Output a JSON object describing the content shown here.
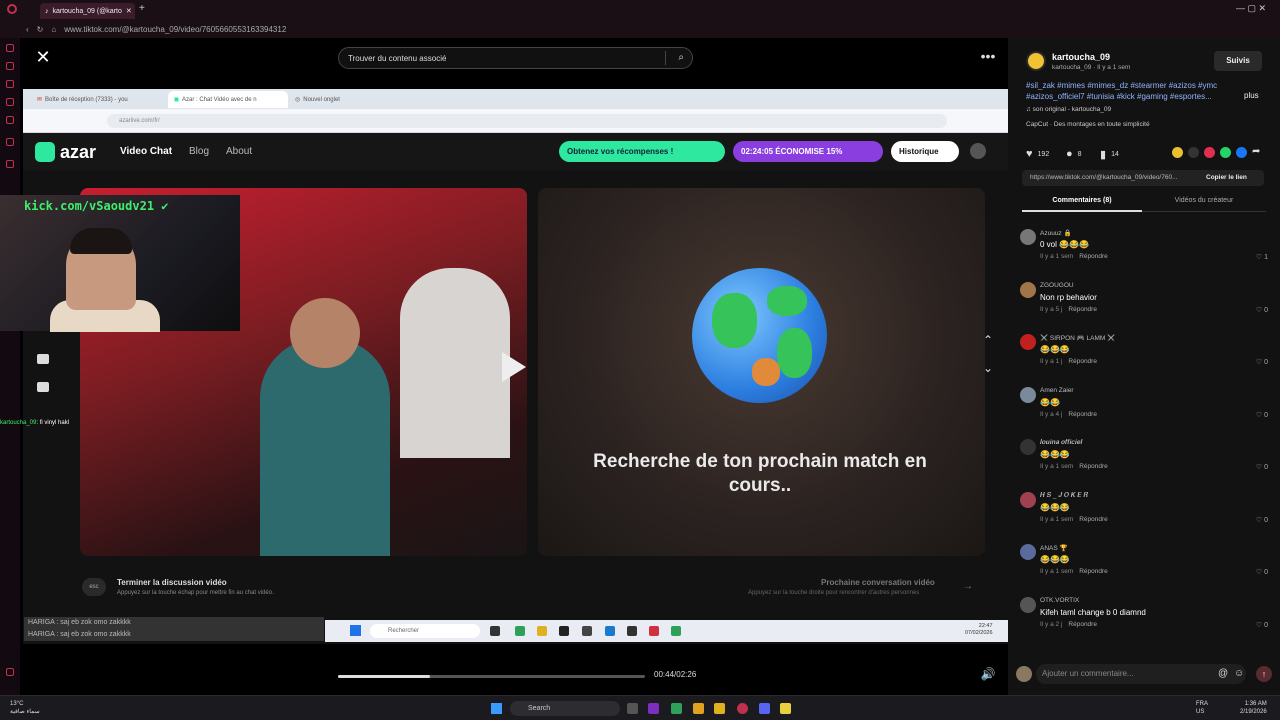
{
  "browser": {
    "tab_title": "kartoucha_09 (@karto",
    "url": "www.tiktok.com/@kartoucha_09/video/7605660553163394312"
  },
  "player": {
    "search_placeholder": "Trouver du contenu associé",
    "time": "00:44/02:26",
    "progress": 0.3
  },
  "inner_screen": {
    "tabs": [
      "Boîte de réception (7333) - you",
      "Azar : Chat Vidéo avec de n",
      "Nouvel onglet"
    ],
    "url": "azarlive.com/fr/",
    "brand": "azar",
    "nav": [
      "Video Chat",
      "Blog",
      "About"
    ],
    "reward_pill": "Obtenez vos récompenses !",
    "timer_pill": "02:24:05  ÉCONOMISE 15%",
    "history_pill": "Historique",
    "match_text": "Recherche de ton prochain match en cours..",
    "esc_label": "esc",
    "end_title": "Terminer la discussion vidéo",
    "end_sub": "Appuyez sur la touche échap pour mettre fin au chat vidéo.",
    "next_title": "Prochaine conversation vidéo",
    "next_sub": "Appuyez sur la touche droite pour rencontrer d'autres personnes",
    "taskbar_search": "Rechercher",
    "taskbar_time": "22:47",
    "taskbar_date": "07/02/2026"
  },
  "overlay": {
    "kick_text": "kick.com/vSaoudv21",
    "chat_user": "kartoucha_09",
    "chat_msg": ": fi vinyl hakl",
    "chat_lines": [
      "HARIGA : saj eb zok omo zakkkk",
      "HARIGA : saj eb zok omo zakkkk"
    ]
  },
  "panel": {
    "username": "kartoucha_09",
    "subline": "kartoucha_09 · Il y a 1 sem",
    "follow_label": "Suivis",
    "hashtags": "#sil_zak #mimes #mimes_dz #stearmer #azizos #ymc #azizos_officiel7 #tunisia #kick #gaming #esportes...",
    "more_label": "plus",
    "sound": "♫  son original - kartoucha_09",
    "capcut": "CapCut · Des montages en toute simplicité",
    "likes": "192",
    "comments_count": "8",
    "saves": "14",
    "link": "https://www.tiktok.com/@kartoucha_09/video/760...",
    "copy_label": "Copier le lien",
    "tab_comments": "Commentaires (8)",
    "tab_videos": "Vidéos du créateur",
    "reply_label": "Répondre",
    "add_comment": "Ajouter un commentaire...",
    "comments": [
      {
        "name": "Azuuuz 🔒",
        "text": "0 vol 😂😂😂",
        "time": "Il y a 1 sem",
        "likes": "1",
        "color": "#777"
      },
      {
        "name": "ZGOUGOU",
        "text": "Non rp behavior",
        "time": "Il y a 5 j",
        "likes": "0",
        "color": "#a0754a"
      },
      {
        "name": "⚔️ SIRPON 🎮 LAMM ⚔️",
        "text": "😂😂😂",
        "time": "Il y a 1 j",
        "likes": "0",
        "color": "#c02020"
      },
      {
        "name": "Amen Zaier",
        "text": "😂😂",
        "time": "Il y a 4 j",
        "likes": "0",
        "color": "#7a8a9a"
      },
      {
        "name": "𝒍𝒐𝒖𝒊𝒏𝒂 𝒐𝒇𝒇𝒊𝒄𝒊𝒆𝒍",
        "text": "😂😂😂",
        "time": "Il y a 1 sem",
        "likes": "0",
        "color": "#333"
      },
      {
        "name": "𝑯 𝑺 _ 𝑱 𝑶 𝑲 𝑬 𝑹",
        "text": "😂😂😂",
        "time": "Il y a 1 sem",
        "likes": "0",
        "color": "#a04050"
      },
      {
        "name": "ANAS 🏆",
        "text": "😂😂😂",
        "time": "Il y a 1 sem",
        "likes": "0",
        "color": "#5a6a9a"
      },
      {
        "name": "OTK.VORTIX",
        "text": "Kifeh taml change b 0 diamnd",
        "time": "Il y a 2 j",
        "likes": "0",
        "color": "#555"
      }
    ]
  },
  "taskbar": {
    "temp": "13°C",
    "weather": "سماء صافية",
    "search": "Search",
    "lang1": "FRA",
    "lang2": "US",
    "time": "1:36 AM",
    "date": "2/19/2026"
  }
}
